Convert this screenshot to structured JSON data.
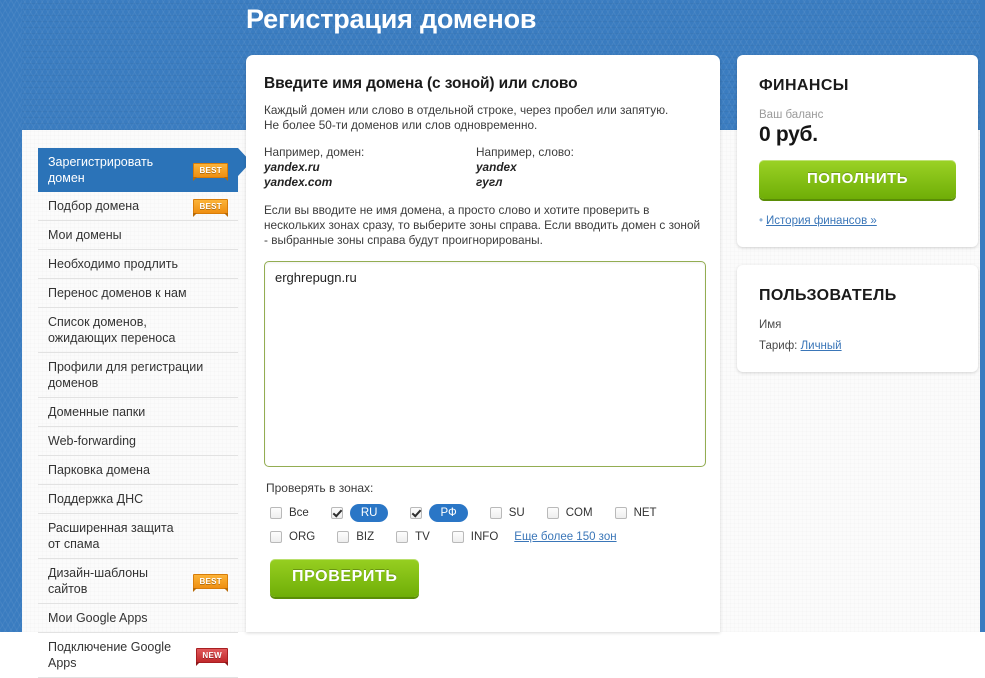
{
  "header": {
    "title": "Регистрация доменов",
    "bg_color": "#3a7cc0"
  },
  "sidebar": {
    "items": [
      {
        "label": "Зарегистрировать домен",
        "badge": "BEST",
        "badge_type": "best",
        "active": true
      },
      {
        "label": "Подбор домена",
        "badge": "BEST",
        "badge_type": "best",
        "active": false
      },
      {
        "label": "Мои домены",
        "badge": "",
        "badge_type": "",
        "active": false
      },
      {
        "label": "Необходимо продлить",
        "badge": "",
        "badge_type": "",
        "active": false
      },
      {
        "label": "Перенос доменов к нам",
        "badge": "",
        "badge_type": "",
        "active": false
      },
      {
        "label": "Список доменов,\nожидающих переноса",
        "badge": "",
        "badge_type": "",
        "active": false
      },
      {
        "label": "Профили для регистрации\nдоменов",
        "badge": "",
        "badge_type": "",
        "active": false
      },
      {
        "label": "Доменные папки",
        "badge": "",
        "badge_type": "",
        "active": false
      },
      {
        "label": "Web-forwarding",
        "badge": "",
        "badge_type": "",
        "active": false
      },
      {
        "label": "Парковка домена",
        "badge": "",
        "badge_type": "",
        "active": false
      },
      {
        "label": "Поддержка ДНС",
        "badge": "",
        "badge_type": "",
        "active": false
      },
      {
        "label": "Расширенная защита\nот спама",
        "badge": "",
        "badge_type": "",
        "active": false
      },
      {
        "label": "Дизайн-шаблоны сайтов",
        "badge": "BEST",
        "badge_type": "best",
        "active": false
      },
      {
        "label": "Мои Google Apps",
        "badge": "",
        "badge_type": "",
        "active": false
      },
      {
        "label": "Подключение Google Apps",
        "badge": "NEW",
        "badge_type": "new",
        "active": false
      }
    ]
  },
  "main": {
    "title": "Введите имя домена (с зоной) или слово",
    "desc_line1": "Каждый домен или слово в отдельной строке, через пробел или запятую.",
    "desc_line2": "Не более 50-ти доменов или слов одновременно.",
    "example_domain_label": "Например, домен:",
    "example_domain_1": "yandex.ru",
    "example_domain_2": "yandex.com",
    "example_word_label": "Например, слово:",
    "example_word_1": "yandex",
    "example_word_2": "гугл",
    "note": "Если вы вводите не имя домена, а просто слово и хотите проверить в нескольких зонах сразу, то выберите зоны справа. Если вводить домен с зоной - выбранные зоны справа будут проигнорированы.",
    "textarea_value": "erghrepugn.ru",
    "textarea_placeholder": "",
    "zones_label": "Проверять в зонах:",
    "zones_row1": [
      {
        "name": "Все",
        "checked": false,
        "pill": false
      },
      {
        "name": "RU",
        "checked": true,
        "pill": true
      },
      {
        "name": "РФ",
        "checked": true,
        "pill": true
      },
      {
        "name": "SU",
        "checked": false,
        "pill": false
      },
      {
        "name": "COM",
        "checked": false,
        "pill": false
      },
      {
        "name": "NET",
        "checked": false,
        "pill": false
      }
    ],
    "zones_row2": [
      {
        "name": "ORG",
        "checked": false,
        "pill": false
      },
      {
        "name": "BIZ",
        "checked": false,
        "pill": false
      },
      {
        "name": "TV",
        "checked": false,
        "pill": false
      },
      {
        "name": "INFO",
        "checked": false,
        "pill": false
      }
    ],
    "more_zones_link": "Еще более 150 зон",
    "check_button": "ПРОВЕРИТЬ"
  },
  "finance": {
    "title": "ФИНАНСЫ",
    "balance_label": "Ваш баланс",
    "balance_value": "0 руб.",
    "topup_button": "ПОПОЛНИТЬ",
    "history_link": "История финансов »",
    "bullet": "•"
  },
  "user": {
    "title": "ПОЛЬЗОВАТЕЛЬ",
    "name_label": "Имя",
    "tariff_label": "Тариф:",
    "tariff_value": "Личный"
  }
}
